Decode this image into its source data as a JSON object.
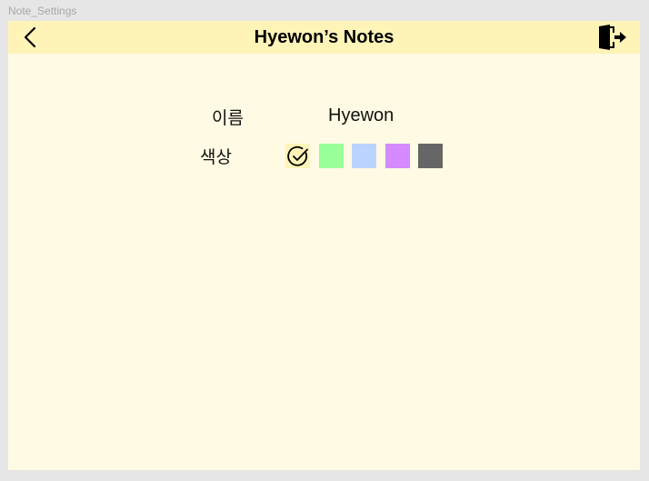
{
  "window": {
    "frame_label": "Note_Settings"
  },
  "header": {
    "title": "Hyewon’s Notes",
    "back_icon": "chevron-left-icon",
    "exit_icon": "logout-icon"
  },
  "settings": {
    "name_label": "이름",
    "name_value": "Hyewon",
    "color_label": "색상",
    "colors": [
      {
        "name": "yellow",
        "hex": "#fff4b8",
        "selected": true
      },
      {
        "name": "green",
        "hex": "#99ff99",
        "selected": false
      },
      {
        "name": "blue",
        "hex": "#bbd4ff",
        "selected": false
      },
      {
        "name": "purple",
        "hex": "#d58aff",
        "selected": false
      },
      {
        "name": "gray",
        "hex": "#666666",
        "selected": false
      }
    ]
  },
  "colors": {
    "background": "#e6e6e6",
    "frame": "#fffae3",
    "topbar": "#fff4b8"
  }
}
